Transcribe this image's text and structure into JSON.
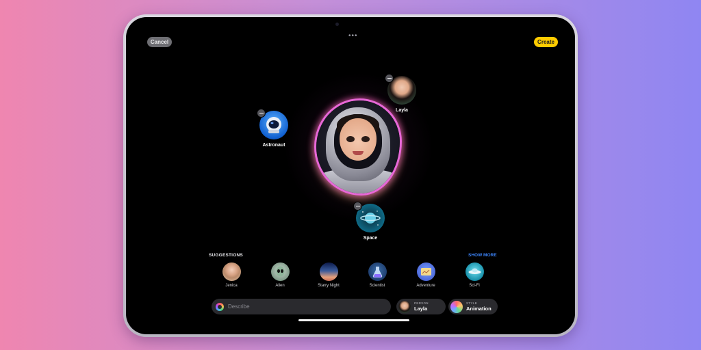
{
  "header": {
    "cancel_label": "Cancel",
    "create_label": "Create",
    "more_glyph": "•••"
  },
  "canvas": {
    "tokens": [
      {
        "id": "astronaut",
        "label": "Astronaut",
        "icon": "astronaut-helmet-icon"
      },
      {
        "id": "layla",
        "label": "Layla",
        "icon": "person-avatar"
      },
      {
        "id": "space",
        "label": "Space",
        "icon": "planet-icon"
      }
    ]
  },
  "suggestions": {
    "heading": "SUGGESTIONS",
    "show_more": "SHOW MORE",
    "items": [
      {
        "label": "Jenica"
      },
      {
        "label": "Alien"
      },
      {
        "label": "Starry Night"
      },
      {
        "label": "Scientist"
      },
      {
        "label": "Adventure"
      },
      {
        "label": "Sci-Fi"
      }
    ]
  },
  "bottom_bar": {
    "describe_placeholder": "Describe",
    "person": {
      "key": "PERSON",
      "value": "Layla"
    },
    "style": {
      "key": "STYLE",
      "value": "Animation"
    }
  },
  "colors": {
    "accent_create": "#ffcc00",
    "link": "#3b82f6",
    "glow": "#e868d8"
  }
}
